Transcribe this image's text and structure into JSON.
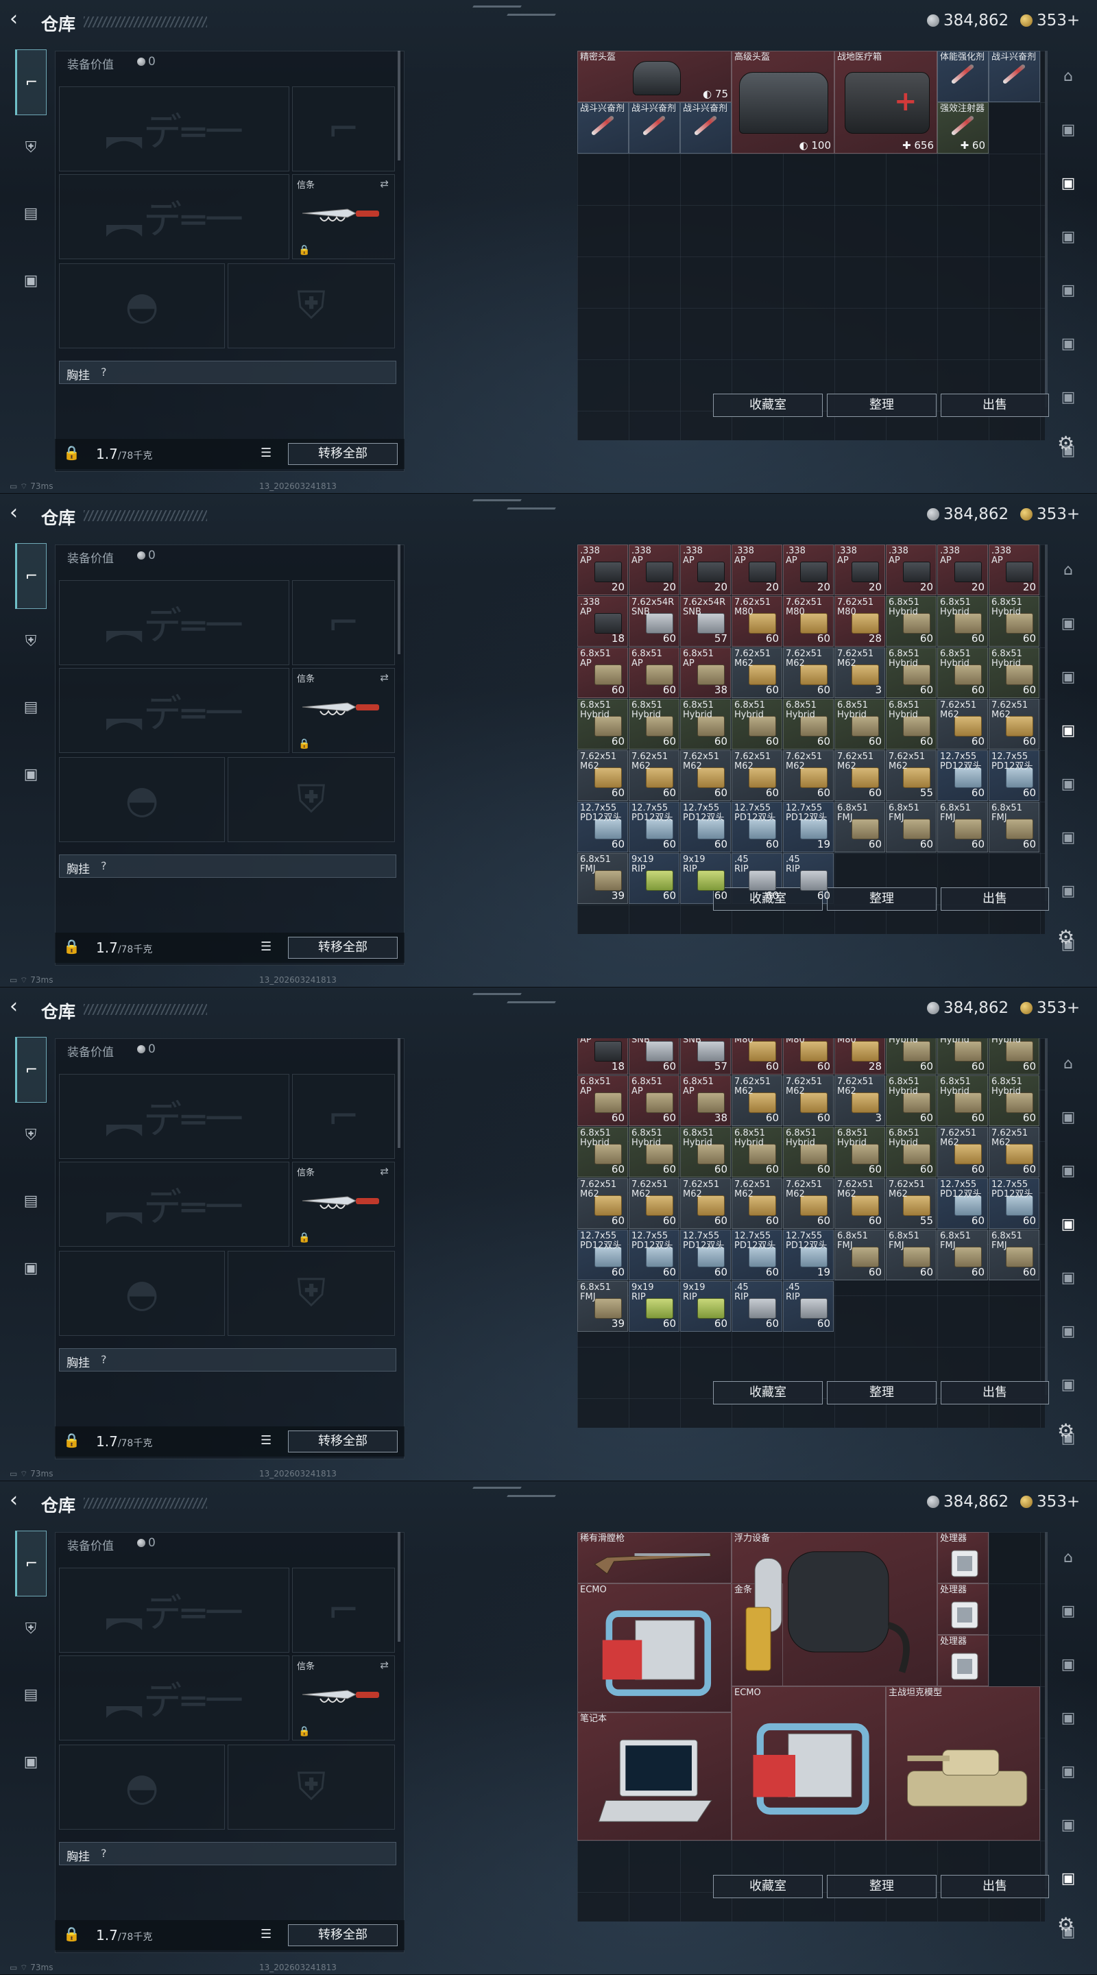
{
  "header": {
    "back_icon": "back-arrow-icon",
    "title": "仓库",
    "silver": "384,862",
    "gold": "353+"
  },
  "loadout": {
    "value_label": "装备价值",
    "value": "0",
    "knife_label": "信条",
    "chest_label": "胸挂",
    "chest_help": "?",
    "weight": "1.7",
    "weight_max": "/78千克",
    "transfer_all": "转移全部",
    "rail_icons": [
      "pistol-icon",
      "armor-icon",
      "backpack-icon",
      "briefcase-icon"
    ]
  },
  "stash": {
    "btn_collection": "收藏室",
    "btn_sort": "整理",
    "btn_sell": "出售"
  },
  "footer": {
    "ping": "73ms",
    "build": "13_202603241813"
  },
  "panel1": {
    "items": [
      {
        "name": "精密头盔",
        "stat": "75"
      },
      {
        "name": "高级头盔",
        "stat": "100"
      },
      {
        "name": "战地医疗箱",
        "stat": "656"
      },
      {
        "name": "体能强化剂"
      },
      {
        "name": "战斗兴奋剂"
      },
      {
        "name": "战斗兴奋剂"
      },
      {
        "name": "战斗兴奋剂"
      },
      {
        "name": "战斗兴奋剂"
      },
      {
        "name": "强效注射器",
        "stat": "60"
      }
    ]
  },
  "ammo": [
    [
      ".338\nAP",
      "20"
    ],
    [
      ".338\nAP",
      "20"
    ],
    [
      ".338\nAP",
      "20"
    ],
    [
      ".338\nAP",
      "20"
    ],
    [
      ".338\nAP",
      "20"
    ],
    [
      ".338\nAP",
      "20"
    ],
    [
      ".338\nAP",
      "20"
    ],
    [
      ".338\nAP",
      "20"
    ],
    [
      ".338\nAP",
      "20"
    ],
    [
      ".338\nAP",
      "18"
    ],
    [
      "7.62x54R\nSNB",
      "60"
    ],
    [
      "7.62x54R\nSNB",
      "57"
    ],
    [
      "7.62x51\nM80",
      "60"
    ],
    [
      "7.62x51\nM80",
      "60"
    ],
    [
      "7.62x51\nM80",
      "28"
    ],
    [
      "6.8x51\nHybrid",
      "60"
    ],
    [
      "6.8x51\nHybrid",
      "60"
    ],
    [
      "6.8x51\nHybrid",
      "60"
    ],
    [
      "6.8x51\nAP",
      "60"
    ],
    [
      "6.8x51\nAP",
      "60"
    ],
    [
      "6.8x51\nAP",
      "38"
    ],
    [
      "7.62x51\nM62",
      "60"
    ],
    [
      "7.62x51\nM62",
      "60"
    ],
    [
      "7.62x51\nM62",
      "3"
    ],
    [
      "6.8x51\nHybrid",
      "60"
    ],
    [
      "6.8x51\nHybrid",
      "60"
    ],
    [
      "6.8x51\nHybrid",
      "60"
    ],
    [
      "6.8x51\nHybrid",
      "60"
    ],
    [
      "6.8x51\nHybrid",
      "60"
    ],
    [
      "6.8x51\nHybrid",
      "60"
    ],
    [
      "6.8x51\nHybrid",
      "60"
    ],
    [
      "6.8x51\nHybrid",
      "60"
    ],
    [
      "6.8x51\nHybrid",
      "60"
    ],
    [
      "6.8x51\nHybrid",
      "60"
    ],
    [
      "7.62x51\nM62",
      "60"
    ],
    [
      "7.62x51\nM62",
      "60"
    ],
    [
      "7.62x51\nM62",
      "60"
    ],
    [
      "7.62x51\nM62",
      "60"
    ],
    [
      "7.62x51\nM62",
      "60"
    ],
    [
      "7.62x51\nM62",
      "60"
    ],
    [
      "7.62x51\nM62",
      "60"
    ],
    [
      "7.62x51\nM62",
      "60"
    ],
    [
      "7.62x51\nM62",
      "55"
    ],
    [
      "12.7x55\nPD12双头",
      "60"
    ],
    [
      "12.7x55\nPD12双头",
      "60"
    ],
    [
      "12.7x55\nPD12双头",
      "60"
    ],
    [
      "12.7x55\nPD12双头",
      "60"
    ],
    [
      "12.7x55\nPD12双头",
      "60"
    ],
    [
      "12.7x55\nPD12双头",
      "60"
    ],
    [
      "12.7x55\nPD12双头",
      "19"
    ],
    [
      "6.8x51\nFMJ",
      "60"
    ],
    [
      "6.8x51\nFMJ",
      "60"
    ],
    [
      "6.8x51\nFMJ",
      "60"
    ],
    [
      "6.8x51\nFMJ",
      "60"
    ],
    [
      "6.8x51\nFMJ",
      "39"
    ],
    [
      "9x19\nRIP",
      "60"
    ],
    [
      "9x19\nRIP",
      "60"
    ],
    [
      ".45\nRIP",
      "60"
    ],
    [
      ".45\nRIP",
      "60"
    ]
  ],
  "panel4": {
    "items": [
      {
        "name": "稀有滑膛枪"
      },
      {
        "name": "浮力设备"
      },
      {
        "name": "处理器"
      },
      {
        "name": "处理器"
      },
      {
        "name": "处理器"
      },
      {
        "name": "ECMO"
      },
      {
        "name": "金条"
      },
      {
        "name": "ECMO"
      },
      {
        "name": "主战坦克模型"
      },
      {
        "name": "笔记本"
      }
    ]
  },
  "colors": {
    "rare_red": "#5a2e34",
    "accent_teal": "#6fc0c8"
  }
}
